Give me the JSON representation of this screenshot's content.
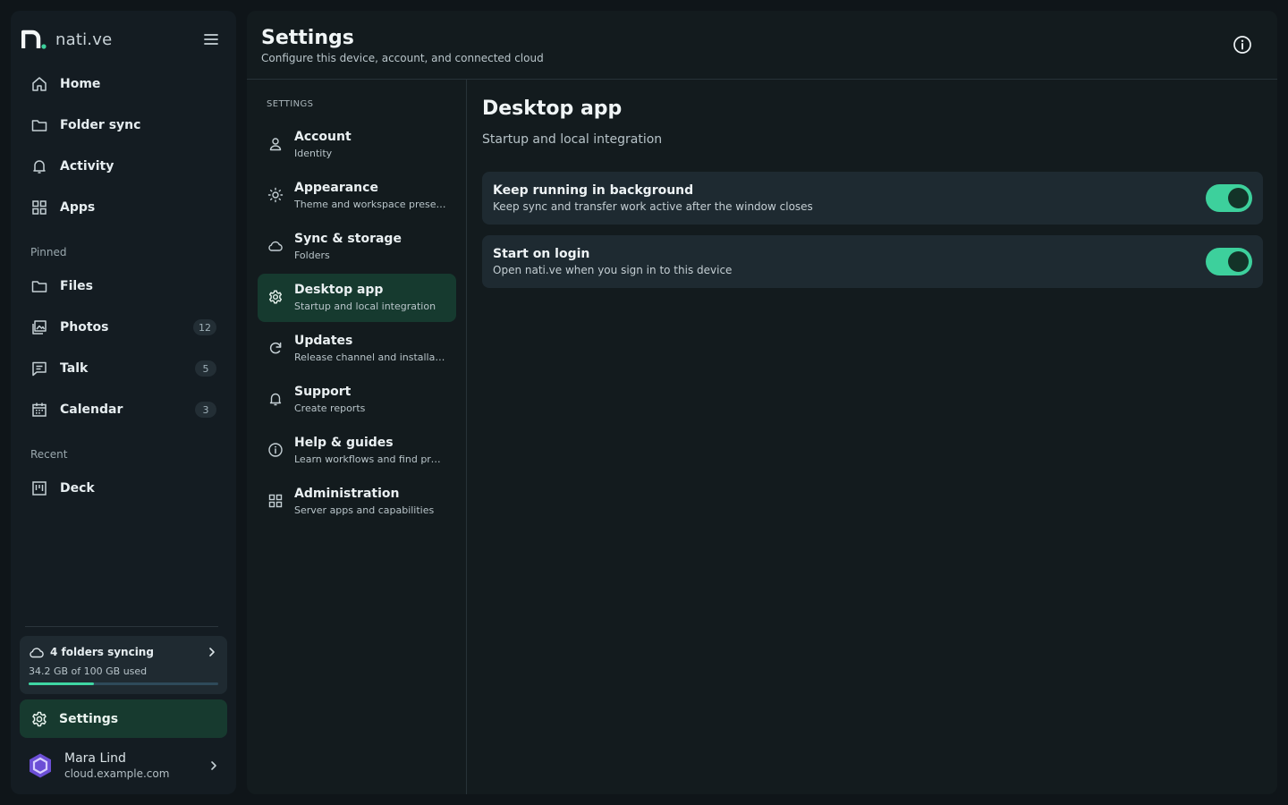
{
  "brand": {
    "name": "nati.ve"
  },
  "nav": [
    {
      "label": "Home",
      "icon": "home-icon"
    },
    {
      "label": "Folder sync",
      "icon": "folder-icon"
    },
    {
      "label": "Activity",
      "icon": "bell-icon"
    },
    {
      "label": "Apps",
      "icon": "grid-icon"
    }
  ],
  "pinned": {
    "label": "Pinned",
    "items": [
      {
        "label": "Files",
        "icon": "folder-icon",
        "badge": ""
      },
      {
        "label": "Photos",
        "icon": "photos-icon",
        "badge": "12"
      },
      {
        "label": "Talk",
        "icon": "chat-icon",
        "badge": "5"
      },
      {
        "label": "Calendar",
        "icon": "calendar-icon",
        "badge": "3"
      }
    ]
  },
  "recent": {
    "label": "Recent",
    "items": [
      {
        "label": "Deck",
        "icon": "deck-icon"
      }
    ]
  },
  "sync": {
    "title": "4 folders syncing",
    "usage": "34.2 GB of 100 GB used",
    "used_fraction": 0.342
  },
  "settings_button": {
    "label": "Settings"
  },
  "user": {
    "name": "Mara Lind",
    "host": "cloud.example.com"
  },
  "header": {
    "title": "Settings",
    "subtitle": "Configure this device, account, and connected cloud"
  },
  "settings_nav": {
    "label": "SETTINGS",
    "items": [
      {
        "title": "Account",
        "sub": "Identity",
        "icon": "user-icon"
      },
      {
        "title": "Appearance",
        "sub": "Theme and workspace presen...",
        "icon": "sun-icon"
      },
      {
        "title": "Sync & storage",
        "sub": "Folders",
        "icon": "cloud-icon"
      },
      {
        "title": "Desktop app",
        "sub": "Startup and local integration",
        "icon": "gear-icon"
      },
      {
        "title": "Updates",
        "sub": "Release channel and installation",
        "icon": "refresh-icon"
      },
      {
        "title": "Support",
        "sub": "Create reports",
        "icon": "bell-icon"
      },
      {
        "title": "Help & guides",
        "sub": "Learn workflows and find proj...",
        "icon": "info-icon"
      },
      {
        "title": "Administration",
        "sub": "Server apps and capabilities",
        "icon": "grid-icon"
      }
    ]
  },
  "content": {
    "title": "Desktop app",
    "subtitle": "Startup and local integration",
    "options": [
      {
        "title": "Keep running in background",
        "desc": "Keep sync and transfer work active after the window closes",
        "enabled": true
      },
      {
        "title": "Start on login",
        "desc": "Open nati.ve when you sign in to this device",
        "enabled": true
      }
    ]
  },
  "colors": {
    "accent": "#3dd09c",
    "active_bg": "#173a2f",
    "background": "#0f1519"
  }
}
